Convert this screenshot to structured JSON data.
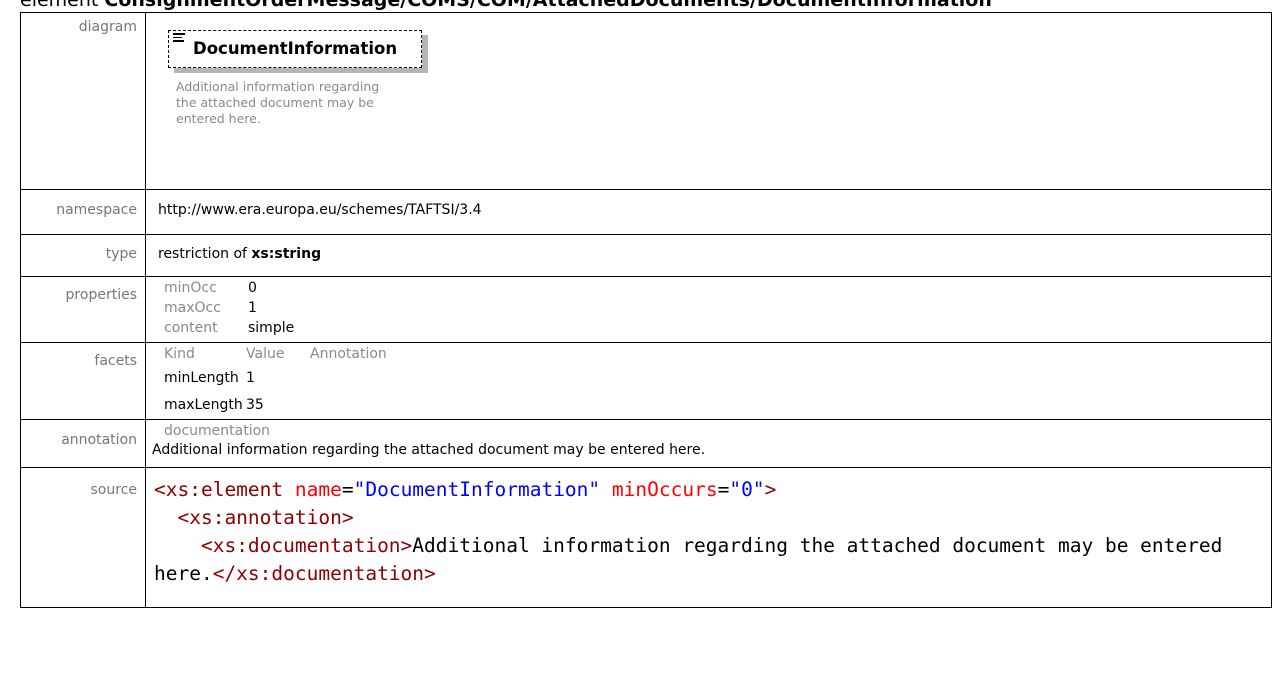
{
  "title": {
    "prefix": "element",
    "name": "ConsignmentOrderMessage/COMS/COM/AttachedDocuments/DocumentInformation"
  },
  "rows": {
    "diagram": {
      "label": "diagram",
      "box_name": "DocumentInformation",
      "box_doc": "Additional information regarding the attached document may be entered here."
    },
    "namespace": {
      "label": "namespace",
      "value": "http://www.era.europa.eu/schemes/TAFTSI/3.4"
    },
    "type": {
      "label": "type",
      "prefix": "restriction of ",
      "value": "xs:string"
    },
    "properties": {
      "label": "properties",
      "items": [
        {
          "key": "minOcc",
          "value": "0"
        },
        {
          "key": "maxOcc",
          "value": "1"
        },
        {
          "key": "content",
          "value": "simple"
        }
      ]
    },
    "facets": {
      "label": "facets",
      "headers": [
        "Kind",
        "Value",
        "Annotation"
      ],
      "items": [
        {
          "kind": "minLength",
          "value": "1"
        },
        {
          "kind": "maxLength",
          "value": "35"
        }
      ]
    },
    "annotation": {
      "label": "annotation",
      "header": "documentation",
      "text": "Additional information regarding the attached document may be entered here."
    },
    "source": {
      "label": "source",
      "line1_tag": "<xs:element",
      "line1_attr1": "name",
      "line1_val1": "\"DocumentInformation\"",
      "line1_attr2": "minOccurs",
      "line1_val2": "\"0\"",
      "line1_close": ">",
      "line2_tag": "<xs:annotation>",
      "line3_tag": "<xs:documentation>",
      "line3_text": "Additional information regarding the attached document may be entered here.",
      "line3_close": "</xs:documentation>"
    }
  }
}
